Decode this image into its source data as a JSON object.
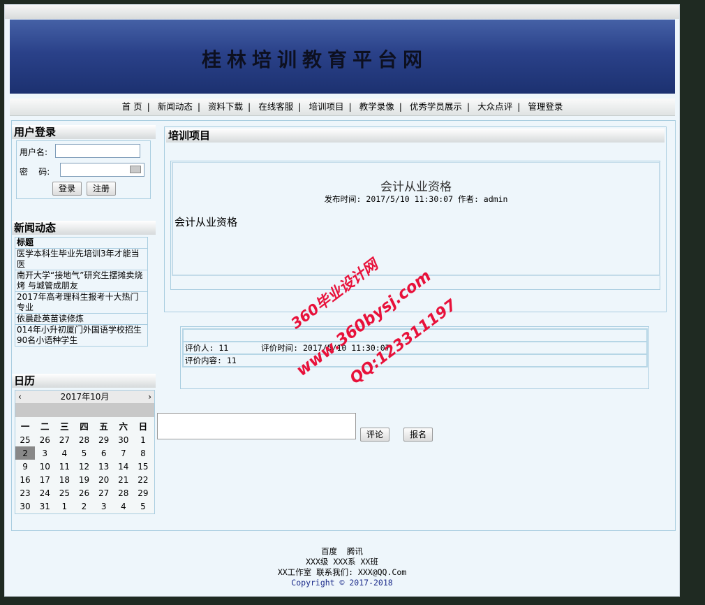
{
  "banner": {
    "title": "桂林培训教育平台网"
  },
  "nav": {
    "items": [
      "首 页",
      "新闻动态",
      "资料下载",
      "在线客服",
      "培训项目",
      "教学录像",
      "优秀学员展示",
      "大众点评",
      "管理登录"
    ],
    "separator": "|"
  },
  "login": {
    "heading": "用户登录",
    "username_label": "用户名:",
    "password_label": "密    码:",
    "login_button": "登录",
    "register_button": "注册"
  },
  "news": {
    "heading": "新闻动态",
    "col_header": "标题",
    "rows": [
      "医学本科生毕业先培训3年才能当医",
      "南开大学“接地气”研究生摆摊卖烧烤 与城管成朋友",
      "2017年高考理科生报考十大热门专业",
      "依晨赴英苗读修炼",
      "014年小升初厦门外国语学校招生90名小语种学生"
    ]
  },
  "calendar": {
    "heading": "日历",
    "month_label": "2017年10月",
    "prev": "‹",
    "next": "›",
    "weekdays": [
      "一",
      "二",
      "三",
      "四",
      "五",
      "六",
      "日"
    ],
    "weeks": [
      [
        "25",
        "26",
        "27",
        "28",
        "29",
        "30",
        "1"
      ],
      [
        "2",
        "3",
        "4",
        "5",
        "6",
        "7",
        "8"
      ],
      [
        "9",
        "10",
        "11",
        "12",
        "13",
        "14",
        "15"
      ],
      [
        "16",
        "17",
        "18",
        "19",
        "20",
        "21",
        "22"
      ],
      [
        "23",
        "24",
        "25",
        "26",
        "27",
        "28",
        "29"
      ],
      [
        "30",
        "31",
        "1",
        "2",
        "3",
        "4",
        "5"
      ]
    ],
    "selected": "2"
  },
  "content": {
    "heading": "培训项目",
    "article_title": "会计从业资格",
    "article_meta": "发布时间: 2017/5/10 11:30:07 作者: admin",
    "article_body": "会计从业资格"
  },
  "review": {
    "reviewer": "评价人: 11",
    "time": "评价时间: 2017/5/10 11:30:07",
    "content": "评价内容: 11"
  },
  "actions": {
    "comment_button": "评论",
    "signup_button": "报名"
  },
  "watermark": {
    "line1": "360毕业设计网",
    "line2": "www.360bysj.com",
    "line3": "QQ:123311197"
  },
  "footer": {
    "links": [
      "百度",
      "腾讯"
    ],
    "line2": "XXX级 XXX系 XX班",
    "line3": "XX工作室 联系我们: XXX@QQ.Com",
    "copyright": "Copyright © 2017-2018"
  }
}
